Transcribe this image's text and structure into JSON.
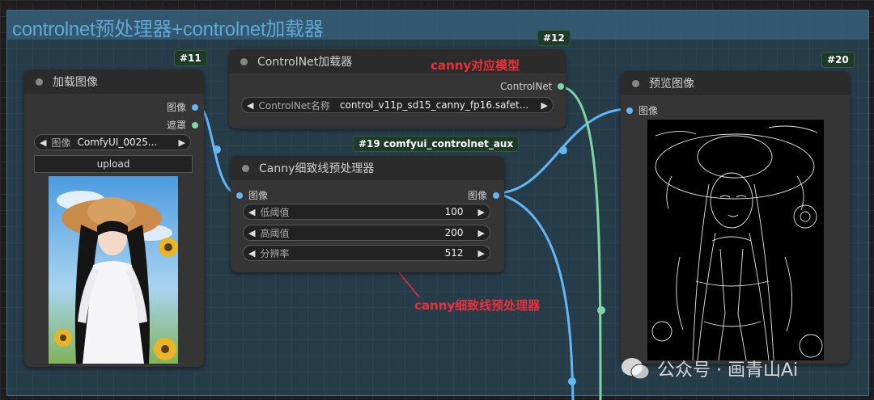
{
  "group": {
    "title": "controlnet预处理器+controlnet加载器"
  },
  "nodes": {
    "load_image": {
      "badge": "#11",
      "title": "加载图像",
      "outputs": [
        "图像",
        "遮罩"
      ],
      "image_widget": {
        "label": "图像",
        "value": "ComfyUI_0025..."
      },
      "upload_label": "upload"
    },
    "controlnet_loader": {
      "badge": "#12",
      "title": "ControlNet加载器",
      "output": "ControlNet",
      "widget": {
        "label": "ControlNet名称",
        "value": "control_v11p_sd15_canny_fp16.safet..."
      }
    },
    "canny": {
      "badge": "#19 comfyui_controlnet_aux",
      "title": "Canny细致线预处理器",
      "input": "图像",
      "output": "图像",
      "widgets": [
        {
          "label": "低阈值",
          "value": "100"
        },
        {
          "label": "高阈值",
          "value": "200"
        },
        {
          "label": "分辨率",
          "value": "512"
        }
      ]
    },
    "preview": {
      "badge": "#20",
      "title": "预览图像",
      "input": "图像"
    }
  },
  "annotations": {
    "model": "canny对应模型",
    "preprocessor": "canny细致线预处理器"
  },
  "watermark": "公众号 · 画青山Ai",
  "colors": {
    "image_link": "#64b5f6",
    "controlnet_link": "#7ed6a5",
    "annotation": "#e8303a"
  }
}
